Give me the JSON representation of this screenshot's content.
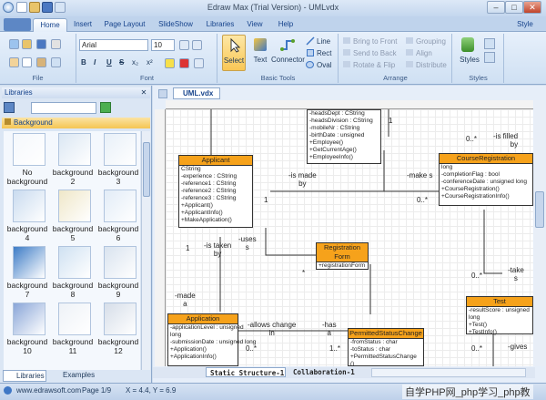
{
  "window": {
    "title": "Edraw Max (Trial Version) - UMLvdx",
    "min": "–",
    "max": "□",
    "close": "✕"
  },
  "tabs": [
    "Home",
    "Insert",
    "Page Layout",
    "SlideShow",
    "Libraries",
    "View",
    "Help"
  ],
  "style_label": "Style",
  "ribbon": {
    "file_label": "File",
    "font": {
      "name": "Arial",
      "size": "10",
      "label": "Font",
      "bold": "B",
      "italic": "I",
      "underline": "U",
      "strike": "S",
      "sub": "x₂",
      "sup": "x²"
    },
    "tools": {
      "select": "Select",
      "text": "Text",
      "connector": "Connector",
      "line": "Line",
      "rect": "Rect",
      "oval": "Oval",
      "label": "Basic Tools"
    },
    "arrange": {
      "bring_front": "Bring to Front",
      "send_back": "Send to Back",
      "rotate": "Rotate & Flip",
      "grouping": "Grouping",
      "align": "Align",
      "distribute": "Distribute",
      "label": "Arrange"
    },
    "styles": {
      "styles": "Styles",
      "label": "Styles"
    }
  },
  "libraries": {
    "title": "Libraries",
    "section": "Background",
    "items": [
      [
        "No",
        "background"
      ],
      [
        "background",
        "2"
      ],
      [
        "background",
        "3"
      ],
      [
        "background",
        "4"
      ],
      [
        "background",
        "5"
      ],
      [
        "background",
        "6"
      ],
      [
        "background",
        "7"
      ],
      [
        "background",
        "8"
      ],
      [
        "background",
        "9"
      ],
      [
        "background",
        "10"
      ],
      [
        "background",
        "11"
      ],
      [
        "background",
        "12"
      ]
    ],
    "tab_libraries": "Libraries",
    "tab_examples": "Examples"
  },
  "document": {
    "tab": "UML.vdx"
  },
  "diagram": {
    "applicant": {
      "title": "Applicant",
      "lines": [
        "CString",
        "-experience : CString",
        "-reference1 : CString",
        "-reference2 : CString",
        "-reference3 : CString",
        "+Applicant()",
        "+ApplicantInfo()",
        "+MakeApplication()"
      ]
    },
    "department": {
      "lines": [
        "-headsDept : CString",
        "-headsDivision : CString",
        "-mobileNr : CString",
        "-birthDate : unsigned",
        "+Employee()",
        "+GetCurrentAge()",
        "+EmployeeInfo()"
      ]
    },
    "course": {
      "title": "CourseRegistration",
      "lines": [
        "long",
        "-completionFlag : bool",
        "-conferenceDate : unsigned long",
        "+CourseRegistration()",
        "+CourseRegistrationInfo()"
      ]
    },
    "registration": {
      "title": "Registration Form",
      "lines": [
        "+registrationForm"
      ]
    },
    "application": {
      "title": "Application",
      "lines": [
        "-applicationLevel : unsigned",
        "long",
        "-submissionDate : unsigned long",
        "+Application()",
        "+ApplicationInfo()"
      ]
    },
    "permitted": {
      "title": "PermittedStatusChange",
      "lines": [
        "-fromStatus : char",
        "-toStatus : char",
        "+PermittedStatusChange",
        "()"
      ]
    },
    "test": {
      "title": "Test",
      "lines": [
        "-resultScore : unsigned",
        "long",
        "+Test()",
        "+TestInfo()"
      ]
    },
    "labels": {
      "is_made_by": [
        "-is made",
        "by"
      ],
      "make_s": "-make s",
      "is_filled": [
        "-is filled",
        "by"
      ],
      "is_taken_by": [
        "-is taken",
        "by"
      ],
      "uses": [
        "-uses",
        "s"
      ],
      "made_a": [
        "-made",
        "a"
      ],
      "allows_change": [
        "-allows change",
        "in"
      ],
      "has_a": [
        "-has",
        "a"
      ],
      "takes": [
        "-take",
        "s"
      ],
      "gives": "-gives",
      "m1": "1",
      "m0": "0..*",
      "m1b": "1",
      "m0b": "0..*",
      "m1c": "1",
      "m0c": "0..*",
      "m0d": "0..*",
      "m1d": "1",
      "m1e": "1..*",
      "m0e": "0..*",
      "m0f": "0..*",
      "m1f": "1"
    }
  },
  "sheets": [
    "Static Structure-1",
    "Collaboration-1"
  ],
  "status": {
    "website": "www.edrawsoft.com",
    "page": "Page 1/9",
    "coords": "X = 4.4, Y = 6.9"
  },
  "watermark": "自学PHP网_php学习_php教"
}
